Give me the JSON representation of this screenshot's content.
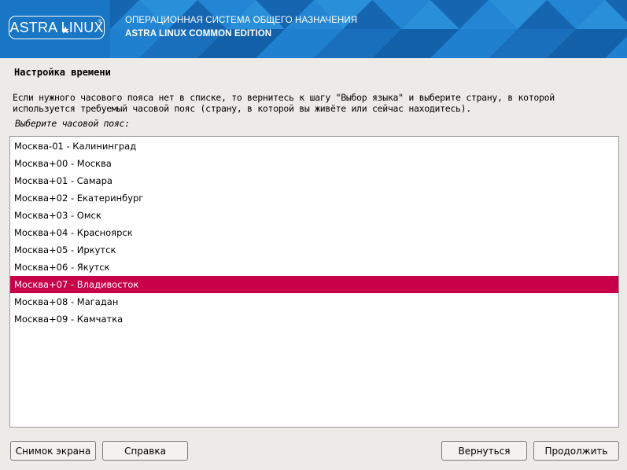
{
  "header": {
    "logo_text": "ASTRA LINUX",
    "logo_reg": "®",
    "os_title": "ОПЕРАЦИОННАЯ СИСТЕМА ОБЩЕГО НАЗНАЧЕНИЯ",
    "edition": "ASTRA LINUX COMMON EDITION",
    "brand_color": "#1976c4"
  },
  "page": {
    "title": "Настройка времени",
    "description_line1": "Если нужного часового пояса нет в списке, то вернитесь к шагу \"Выбор языка\" и выберите страну, в которой",
    "description_line2": "используется требуемый часовой пояс (страну, в которой вы живёте или сейчас находитесь).",
    "prompt": "Выберите часовой пояс:"
  },
  "timezones": {
    "items": [
      "Москва-01 - Калининград",
      "Москва+00 - Москва",
      "Москва+01 - Самара",
      "Москва+02 - Екатеринбург",
      "Москва+03 - Омск",
      "Москва+04 - Красноярск",
      "Москва+05 - Иркутск",
      "Москва+06 - Якутск",
      "Москва+07 - Владивосток",
      "Москва+08 - Магадан",
      "Москва+09 - Камчатка"
    ],
    "selected_value": "Москва+07 - Владивосток",
    "selection_color": "#c8004a"
  },
  "buttons": {
    "screenshot": "Снимок экрана",
    "help": "Справка",
    "back": "Вернуться",
    "continue": "Продолжить"
  }
}
